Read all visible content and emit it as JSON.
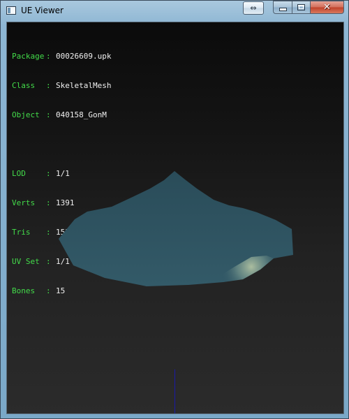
{
  "window": {
    "title": "UE Viewer",
    "buttons": {
      "fullscreen": "⇔",
      "minimize": "",
      "maximize": "",
      "close": "✕"
    }
  },
  "info": {
    "package": {
      "label": "Package",
      "value": "00026609.upk"
    },
    "class": {
      "label": "Class",
      "value": "SkeletalMesh"
    },
    "object": {
      "label": "Object",
      "value": "040158_GonM"
    },
    "lod": {
      "label": "LOD",
      "value": "1/1"
    },
    "verts": {
      "label": "Verts",
      "value": "1391"
    },
    "tris": {
      "label": "Tris",
      "value": "1532"
    },
    "uvset": {
      "label": "UV Set",
      "value": "1/1"
    },
    "bones": {
      "label": "Bones",
      "value": "15"
    },
    "separator": ":"
  },
  "colors": {
    "label": "#43dc4a",
    "value": "#f0f0f0",
    "mesh": "#2f5563",
    "axis": "#1a1aa8"
  }
}
